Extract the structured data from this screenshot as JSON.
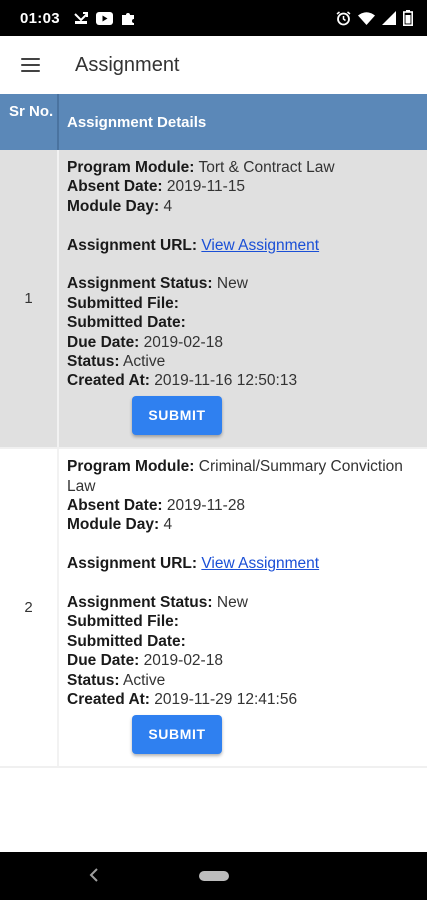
{
  "status_bar": {
    "time": "01:03",
    "icons_left": [
      "missed-call-icon",
      "youtube-icon",
      "puzzle-icon"
    ],
    "icons_right": [
      "alarm-icon",
      "wifi-icon",
      "signal-icon",
      "battery-icon"
    ]
  },
  "app_bar": {
    "title": "Assignment",
    "menu_icon": "menu-icon"
  },
  "table": {
    "headers": {
      "sr": "Sr No.",
      "details": "Assignment Details"
    },
    "labels": {
      "program_module": "Program Module:",
      "absent_date": "Absent Date:",
      "module_day": "Module Day:",
      "assignment_url": "Assignment URL:",
      "assignment_status": "Assignment Status:",
      "submitted_file": "Submitted File:",
      "submitted_date": "Submitted Date:",
      "due_date": "Due Date:",
      "status": "Status:",
      "created_at": "Created At:"
    },
    "rows": [
      {
        "sr": "1",
        "program_module": "Tort & Contract Law",
        "absent_date": "2019-11-15",
        "module_day": "4",
        "assignment_url": "View Assignment",
        "assignment_status": "New",
        "submitted_file": "",
        "submitted_date": "",
        "due_date": "2019-02-18",
        "status": "Active",
        "created_at": "2019-11-16 12:50:13",
        "submit_label": "SUBMIT"
      },
      {
        "sr": "2",
        "program_module": "Criminal/Summary Conviction Law",
        "absent_date": "2019-11-28",
        "module_day": "4",
        "assignment_url": "View Assignment",
        "assignment_status": "New",
        "submitted_file": "",
        "submitted_date": "",
        "due_date": "2019-02-18",
        "status": "Active",
        "created_at": "2019-11-29 12:41:56",
        "submit_label": "SUBMIT"
      }
    ]
  },
  "colors": {
    "header_bg": "#5b88b8",
    "row_shaded_bg": "#e0e0e0",
    "button_bg": "#2f80f0",
    "link": "#1a4fd6"
  },
  "nav_bar": {
    "icons": [
      "back-icon",
      "home-pill-icon"
    ]
  }
}
